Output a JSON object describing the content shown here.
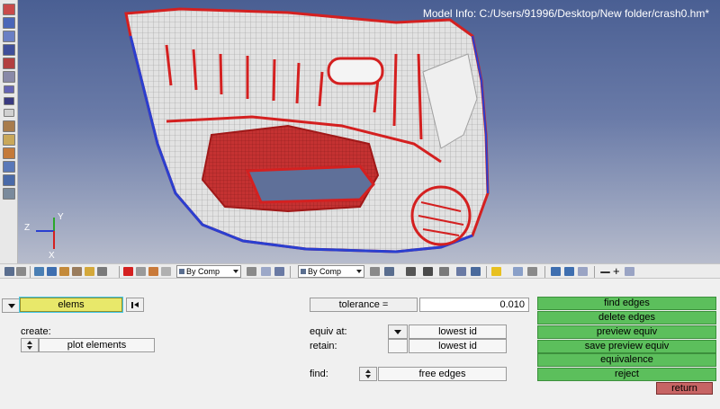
{
  "viewport": {
    "model_info": "Model Info: C:/Users/91996/Desktop/New folder/crash0.hm*",
    "axis_labels": {
      "x": "X",
      "y": "Y",
      "z": "Z"
    }
  },
  "toolbar": {
    "comp_combo_1": "By Comp",
    "comp_combo_2": "By Comp"
  },
  "panel": {
    "collector_selector": "elems",
    "create_label": "create:",
    "create_option": "plot elements",
    "tolerance_label": "tolerance =",
    "tolerance_value": "0.010",
    "equiv_at_label": "equiv at:",
    "equiv_at_value": "lowest id",
    "retain_label": "retain:",
    "retain_value": "lowest id",
    "find_label": "find:",
    "find_option": "free edges"
  },
  "actions": {
    "find_edges": "find edges",
    "delete_edges": "delete edges",
    "preview_equiv": "preview equiv",
    "save_preview_equiv": "save preview equiv",
    "equivalence": "equivalence",
    "reject": "reject",
    "return": "return"
  },
  "colors": {
    "viewport_top": "#4a5f93",
    "viewport_bottom": "#b7bccc",
    "action_green": "#5cbf5c",
    "return_red": "#c76464",
    "selector_yellow": "#e8e86a",
    "free_edge_red": "#d42020",
    "edge_blue": "#2a3fd0"
  },
  "icons": [
    "rotate-icon",
    "pan-icon",
    "zoom-icon",
    "fit-icon",
    "delete-icon",
    "star-icon",
    "arrow-left-icon",
    "arrow-right-icon",
    "minus-icon",
    "plus-icon"
  ]
}
